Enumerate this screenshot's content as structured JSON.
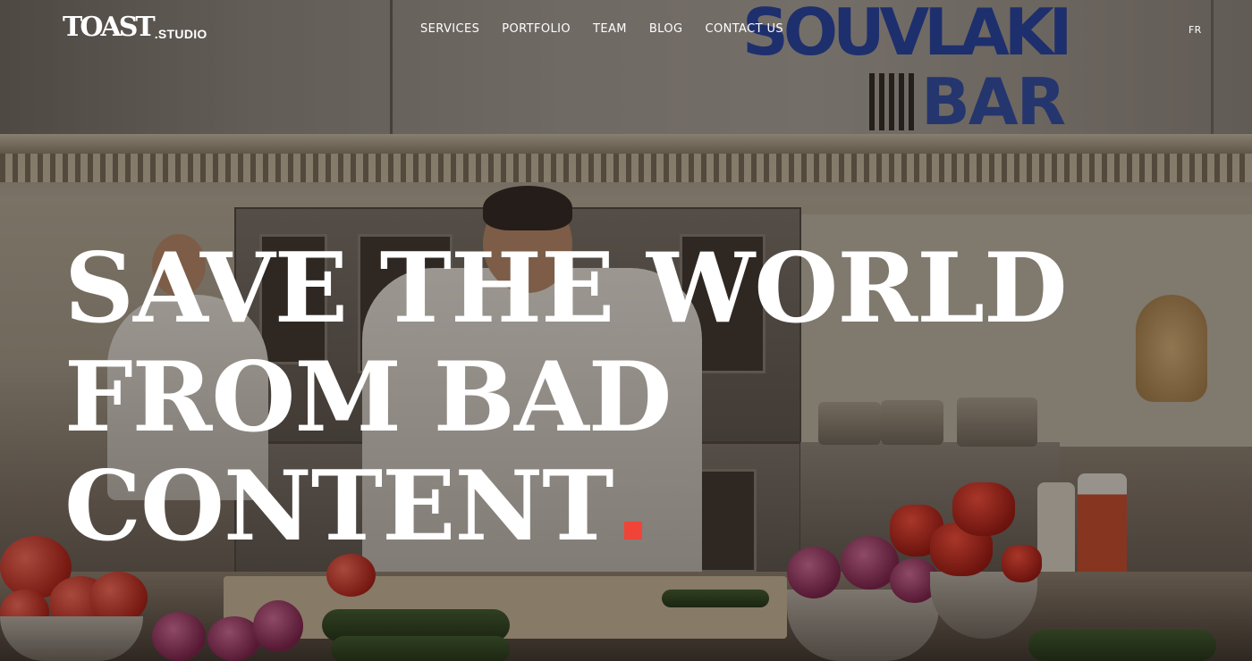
{
  "header": {
    "brand": {
      "name": "TOAST",
      "suffix": ".STUDIO"
    },
    "nav": [
      {
        "label": "SERVICES"
      },
      {
        "label": "PORTFOLIO"
      },
      {
        "label": "TEAM"
      },
      {
        "label": "BLOG"
      },
      {
        "label": "CONTACT US"
      }
    ],
    "language_toggle": "FR"
  },
  "hero": {
    "lines": [
      "SAVE THE WORLD",
      "FROM BAD",
      "CONTENT"
    ],
    "accent_color": "#ef4437"
  },
  "background_sign": {
    "line1": "SOUVLAKI",
    "line2": "BAR"
  },
  "colors": {
    "text": "#ffffff",
    "accent": "#ef4437",
    "sign_blue": "#1f3fa8"
  }
}
